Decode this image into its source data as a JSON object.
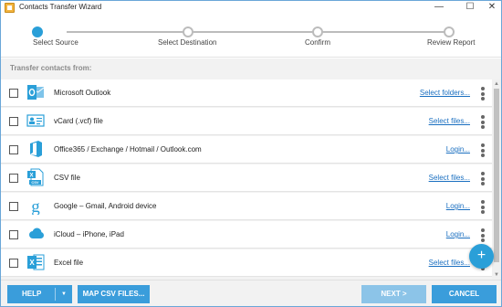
{
  "window": {
    "title": "Contacts Transfer Wizard",
    "controls": {
      "minimize": "—",
      "maximize": "☐",
      "close": "✕"
    }
  },
  "steps": [
    {
      "label": "Select Source",
      "active": true
    },
    {
      "label": "Select Destination",
      "active": false
    },
    {
      "label": "Confirm",
      "active": false
    },
    {
      "label": "Review Report",
      "active": false
    }
  ],
  "section_heading": "Transfer contacts from:",
  "sources": [
    {
      "label": "Microsoft Outlook",
      "link": "Select folders...",
      "icon": "outlook-icon",
      "checked": false
    },
    {
      "label": "vCard (.vcf) file",
      "link": "Select files...",
      "icon": "vcard-icon",
      "checked": false
    },
    {
      "label": "Office365 / Exchange / Hotmail / Outlook.com",
      "link": "Login...",
      "icon": "office365-icon",
      "checked": false
    },
    {
      "label": "CSV file",
      "link": "Select files...",
      "icon": "csv-file-icon",
      "checked": false
    },
    {
      "label": "Google – Gmail, Android device",
      "link": "Login...",
      "icon": "google-icon",
      "checked": false
    },
    {
      "label": "iCloud – iPhone, iPad",
      "link": "Login...",
      "icon": "icloud-icon",
      "checked": false
    },
    {
      "label": "Excel file",
      "link": "Select files...",
      "icon": "excel-icon",
      "checked": false
    }
  ],
  "fab": {
    "label": "+"
  },
  "footer": {
    "help_label": "HELP",
    "map_csv_label": "MAP CSV FILES...",
    "next_label": "NEXT >",
    "cancel_label": "CANCEL"
  },
  "colors": {
    "accent": "#2a9fd8",
    "link": "#1a6fc0",
    "button": "#3a9ddb",
    "button_disabled": "#8cc4e8"
  }
}
